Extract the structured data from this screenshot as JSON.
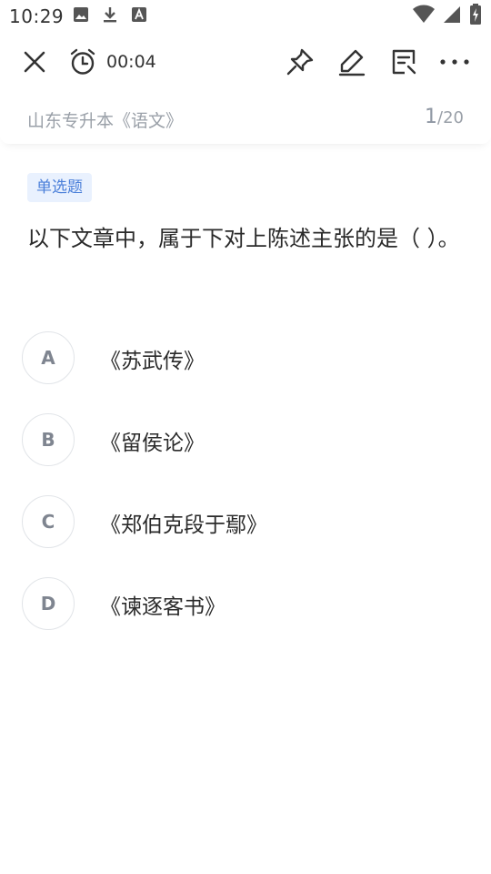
{
  "status": {
    "time": "10:29",
    "left_icons": [
      "image-icon",
      "download-icon",
      "font-icon"
    ],
    "right_icons": [
      "wifi-icon",
      "signal-icon",
      "battery-icon"
    ]
  },
  "toolbar": {
    "timer": "00:04",
    "icons": [
      "close-icon",
      "alarm-clock-icon",
      "pin-icon",
      "edit-icon",
      "note-icon",
      "more-icon"
    ]
  },
  "subheader": {
    "course": "山东专升本《语文》",
    "current": "1",
    "separator": "/",
    "total": "20"
  },
  "question": {
    "type": "单选题",
    "text": "以下文章中，属于下对上陈述主张的是（ ）。",
    "options": [
      {
        "letter": "A",
        "text": "《苏武传》"
      },
      {
        "letter": "B",
        "text": "《留侯论》"
      },
      {
        "letter": "C",
        "text": "《郑伯克段于鄢》"
      },
      {
        "letter": "D",
        "text": "《谏逐客书》"
      }
    ]
  },
  "colors": {
    "tag_bg": "#e9f1fe",
    "tag_text": "#4a7fd9",
    "muted": "#9aa0a8"
  }
}
